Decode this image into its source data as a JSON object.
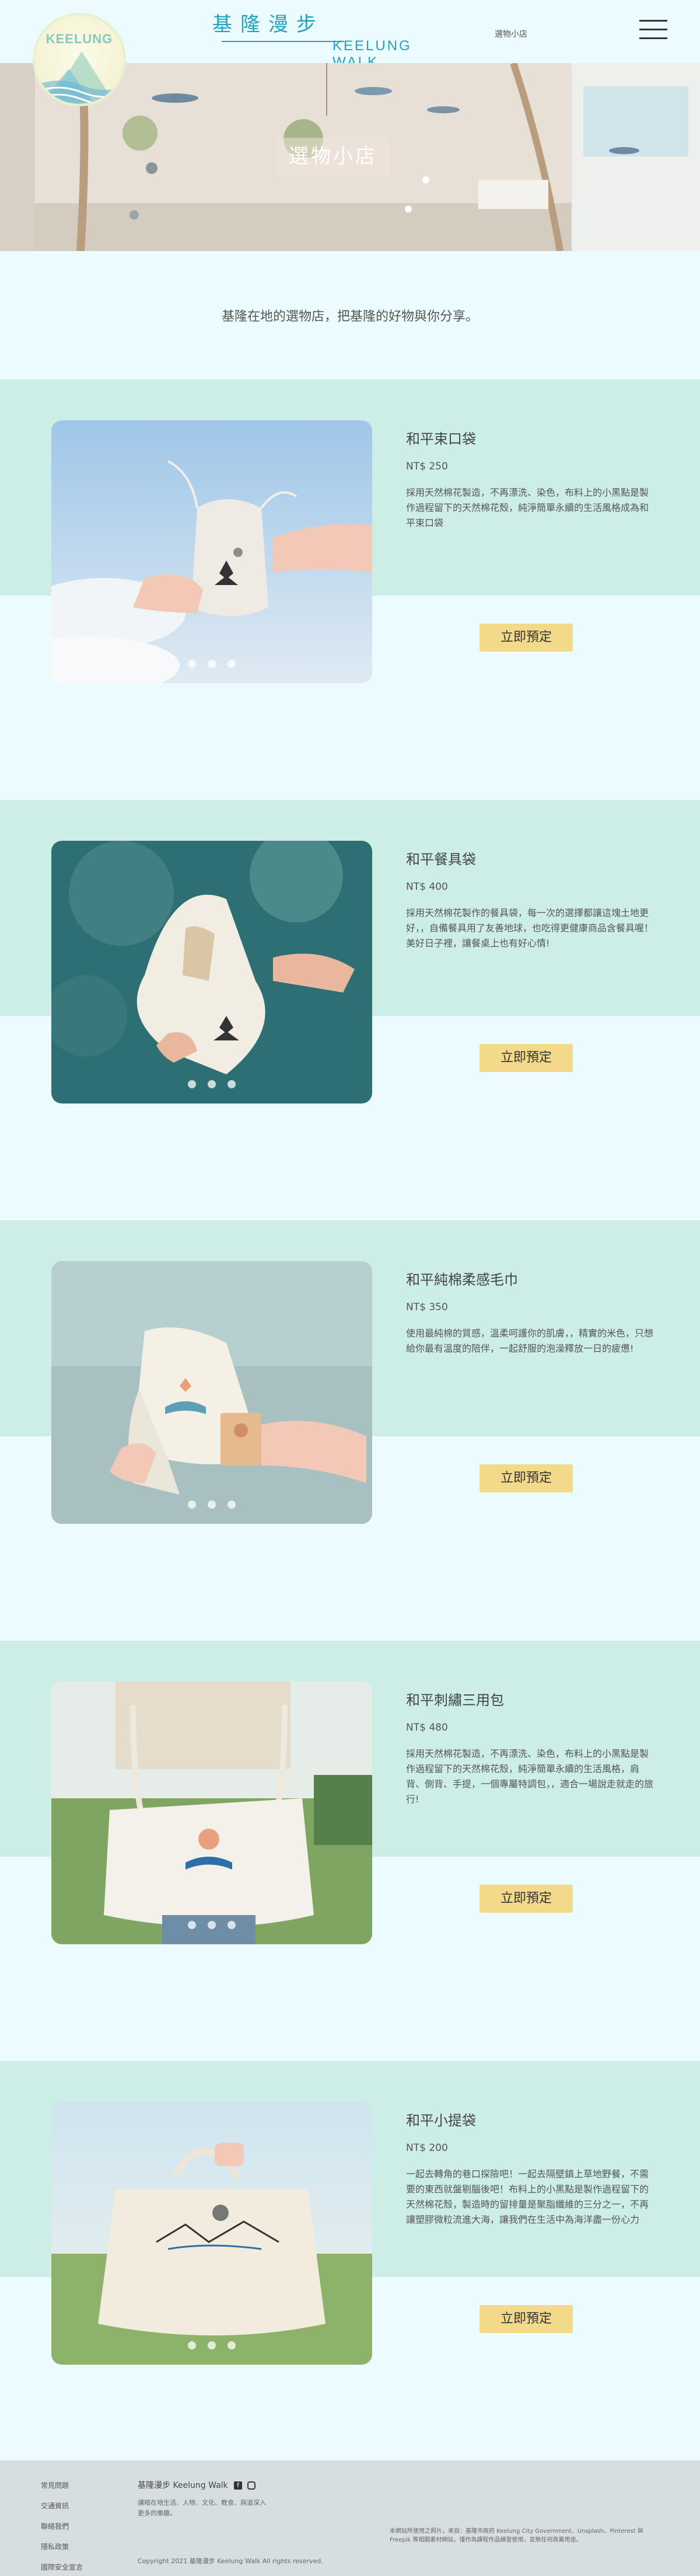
{
  "header": {
    "logo_text": "KEELUNG",
    "brand_cn": "基隆漫步",
    "brand_en": "KEELUNG WALK",
    "nav_link": "選物小店"
  },
  "hero": {
    "label": "選物小店"
  },
  "intro": "基隆在地的選物店，把基隆的好物與你分享。",
  "products": [
    {
      "name": "和平束口袋",
      "price": "NT$ 250",
      "desc": "採用天然棉花製造，不再漂洗、染色，布料上的小黑點是製作過程留下的天然棉花殼，純淨簡單永續的生活風格成為和平束口袋",
      "button": "立即預定"
    },
    {
      "name": "和平餐具袋",
      "price": "NT$ 400",
      "desc": "採用天然棉花製作的餐具袋，每一次的選擇都讓這塊土地更好，，自備餐具用了友善地球，也吃得更健康商品含餐具喔！美好日子裡，讓餐桌上也有好心情!",
      "button": "立即預定"
    },
    {
      "name": "和平純棉柔感毛巾",
      "price": "NT$ 350",
      "desc": "使用最純棉的質感，溫柔呵護你的肌膚，，精實的米色，只想給你最有溫度的陪伴，一起舒服的泡澡釋放一日的疲憊!",
      "button": "立即預定"
    },
    {
      "name": "和平刺繡三用包",
      "price": "NT$ 480",
      "desc": "採用天然棉花製造，不再漂洗、染色，布料上的小黑點是製作過程留下的天然棉花殼，純淨簡單永續的生活風格，肩背、側背、手提，一個專屬特調包，，適合一場說走就走的旅行!",
      "button": "立即預定"
    },
    {
      "name": "和平小提袋",
      "price": "NT$ 200",
      "desc": "一起去轉角的巷口探險吧！一起去隔壁鎮上草地野餐，不需要的東西就盤剔腦後吧！布料上的小黑點是製作過程留下的天然棉花殼，製造時的留排量是聚脂纖維的三分之一，不再讓塑膠微粒流進大海，讓我們在生活中為海洋盡一份心力",
      "button": "立即預定"
    }
  ],
  "footer": {
    "links": [
      "常見問題",
      "交通資訊",
      "聯絡我們",
      "隱私政策",
      "國際安全宣言"
    ],
    "brand": "基隆漫步 Keelung Walk",
    "desc": "讓暗在地生活、人物、文化、教食、與道深入更多的樂趣。",
    "copyright": "Copyright  2021 基隆漫步 Keelung Walk All rights reserved.",
    "legal": "本網站所使用之照片，來自：基隆市政府 Keelung City Government、Unsplash、Pinterest 與 Freepik 等相關素材網站，僅作為課程作品練習使用，並無任何商業用途。"
  },
  "colors": {
    "accent": "#22a2bf",
    "band": "#cdeee6",
    "page": "#ecfbfd",
    "button": "#f3d98a",
    "footer": "#d7dee0"
  }
}
